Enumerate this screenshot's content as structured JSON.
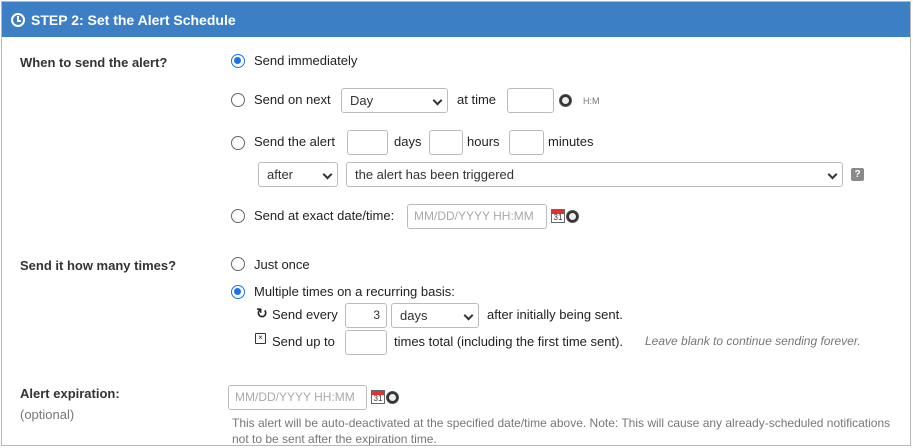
{
  "header": {
    "title": "STEP 2: Set the Alert Schedule"
  },
  "when": {
    "label": "When to send the alert?",
    "immediately": "Send immediately",
    "on_next": "Send on next",
    "on_next_day": "Day",
    "at_time": "at time",
    "hm": "H:M",
    "send_the_alert": "Send the alert",
    "days": "days",
    "hours": "hours",
    "minutes": "minutes",
    "after_value": "after",
    "trigger_value": "the alert has been triggered",
    "help": "?",
    "exact": "Send at exact date/time:",
    "exact_placeholder": "MM/DD/YYYY HH:MM"
  },
  "times": {
    "label": "Send it how many times?",
    "once": "Just once",
    "multiple": "Multiple times on a recurring basis:",
    "send_every": "Send every",
    "every_value": "3",
    "every_unit": "days",
    "after_initial": "after initially being sent.",
    "send_up_to": "Send up to",
    "times_total": "times total (including the first time sent).",
    "leave_blank": "Leave blank to continue sending forever."
  },
  "expiration": {
    "label": "Alert expiration:",
    "optional": "(optional)",
    "placeholder": "MM/DD/YYYY HH:MM",
    "note": "This alert will be auto-deactivated at the specified date/time above. Note: This will cause any already-scheduled notifications not to be sent after the expiration time."
  },
  "calendar_day": "31",
  "colors": {
    "header_bg": "#3d7fc4",
    "radio_checked": "#1a73e8"
  }
}
